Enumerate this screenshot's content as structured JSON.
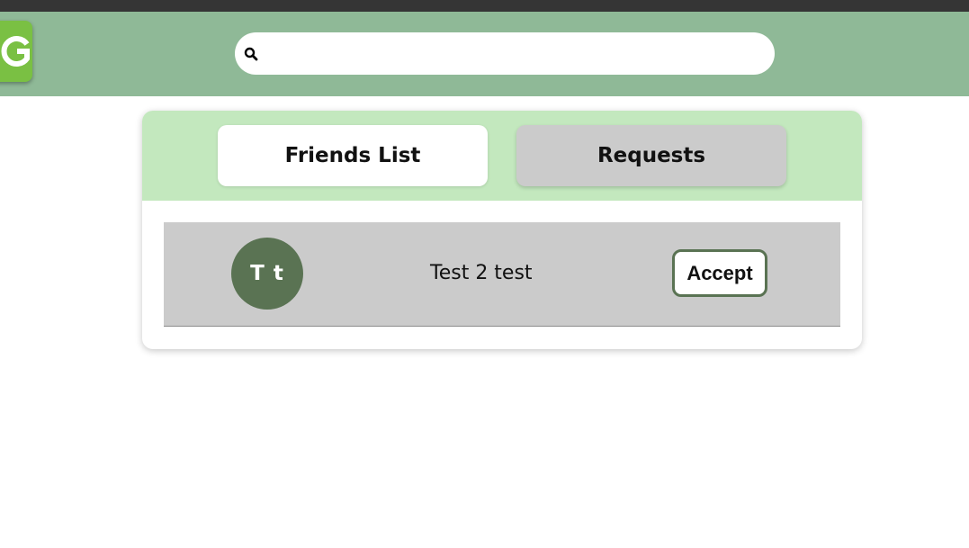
{
  "header": {
    "logo_letter": "G",
    "search": {
      "placeholder": "",
      "value": "",
      "icon": "search-icon"
    }
  },
  "tabs": [
    {
      "label": "Friends List",
      "selected": true
    },
    {
      "label": "Requests",
      "selected": false
    }
  ],
  "requests": [
    {
      "initials": "T t",
      "name": "Test 2 test",
      "action_label": "Accept"
    }
  ],
  "colors": {
    "topbar": "#353535",
    "header": "#8fb997",
    "logo": "#7ac043",
    "tab_bar": "#c3e8be",
    "row": "#cbcbcb",
    "avatar": "#5a7353",
    "accept_border": "#5a7353"
  }
}
